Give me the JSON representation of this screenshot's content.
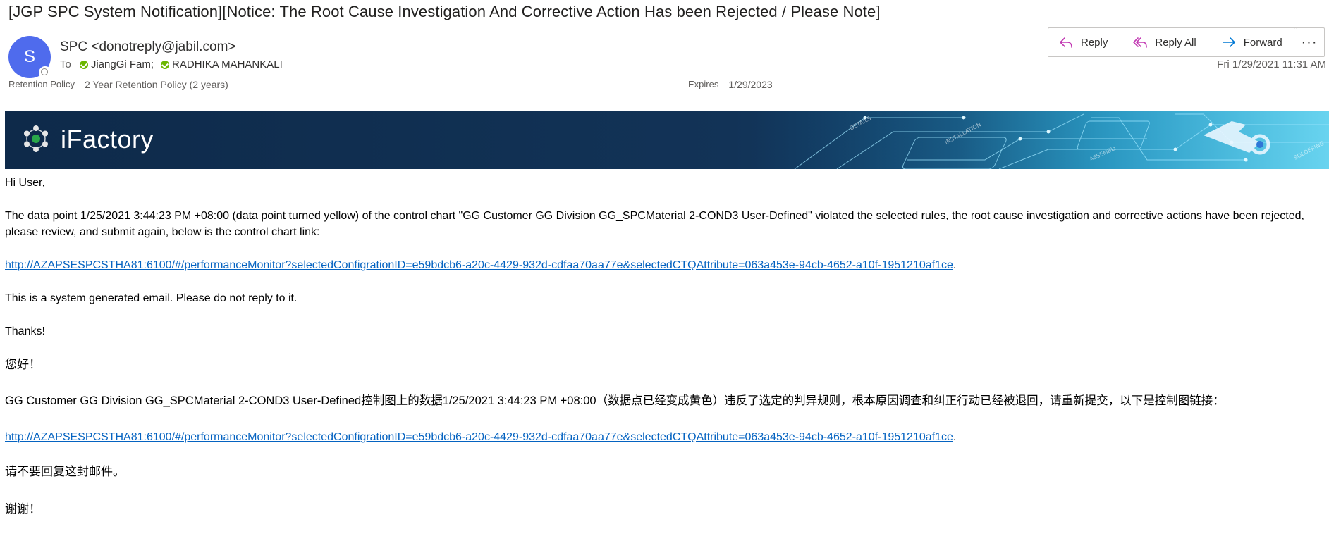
{
  "email": {
    "subject": "[JGP SPC System Notification][Notice: The Root Cause Investigation And Corrective Action Has been Rejected / Please Note]",
    "avatar_initial": "S",
    "sender": "SPC <donotreply@jabil.com>",
    "to_label": "To",
    "recipients": [
      "JiangGi Fam;",
      "RADHIKA MAHANKALI"
    ],
    "retention_label": "Retention Policy",
    "retention_value": "2 Year Retention Policy (2 years)",
    "expires_label": "Expires",
    "expires_value": "1/29/2023",
    "date": "Fri 1/29/2021 11:31 AM"
  },
  "actions": {
    "reply": "Reply",
    "reply_all": "Reply All",
    "forward": "Forward",
    "more": "···"
  },
  "banner": {
    "title": "iFactory",
    "art_labels": [
      "DETAILS",
      "INSTALLATION",
      "ASSEMBLY",
      "SOLDERING"
    ]
  },
  "body": {
    "greeting_en": "Hi User,",
    "paragraph_en": "The data point 1/25/2021 3:44:23 PM +08:00 (data point turned yellow) of the control chart \"GG Customer GG Division GG_SPCMaterial 2-COND3 User-Defined\" violated the selected rules, the root cause investigation and corrective actions have been rejected, please review, and submit again, below is the control chart link:",
    "link": "http://AZAPSESPCSTHA81:6100/#/performanceMonitor?selectedConfigrationID=e59bdcb6-a20c-4429-932d-cdfaa70aa77e&selectedCTQAttribute=063a453e-94cb-4652-a10f-1951210af1ce",
    "period": ".",
    "system_note_en": "This is a system generated email. Please do not reply to it.",
    "thanks_en": "Thanks!",
    "greeting_zh": "您好！",
    "paragraph_zh": "GG Customer GG Division GG_SPCMaterial 2-COND3 User-Defined控制图上的数据1/25/2021 3:44:23 PM +08:00（数据点已经变成黄色）违反了选定的判异规则，根本原因调查和纠正行动已经被退回，请重新提交，以下是控制图链接：",
    "system_note_zh": "请不要回复这封邮件。",
    "thanks_zh": "谢谢！"
  },
  "colors": {
    "avatar": "#4f6bed",
    "link": "#0563c1",
    "reply_icon": "#c239b3",
    "forward_icon": "#0078d4",
    "presence": "#6bb700"
  }
}
